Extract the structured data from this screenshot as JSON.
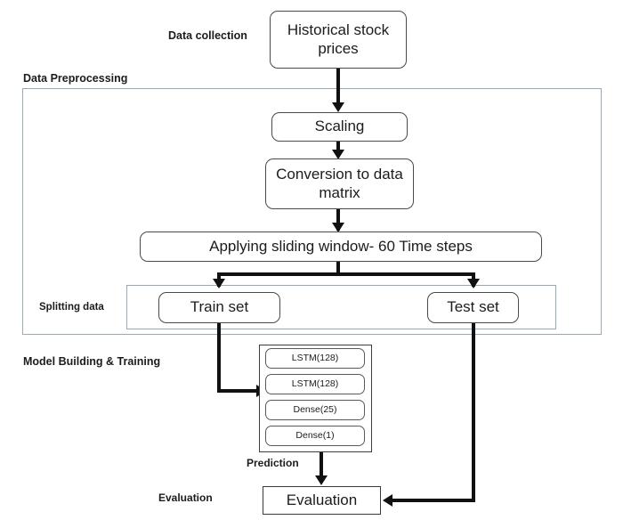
{
  "diagram": {
    "title": "Stock price prediction LSTM pipeline flowchart",
    "background_color": "#ffffff",
    "line_color": "#111111",
    "container_border_color": "#9aaab4",
    "node_border_color": "#4a4a4a"
  },
  "phases": [
    {
      "key": "data_collection",
      "label": "Data collection"
    },
    {
      "key": "data_preprocessing",
      "label": "Data Preprocessing"
    },
    {
      "key": "splitting_data",
      "label": "Splitting data"
    },
    {
      "key": "model_building",
      "label": "Model Building & Training"
    },
    {
      "key": "prediction",
      "label": "Prediction"
    },
    {
      "key": "evaluation",
      "label": "Evaluation"
    }
  ],
  "nodes": {
    "source": {
      "label": "Historical stock prices"
    },
    "scaling": {
      "label": "Scaling"
    },
    "conversion": {
      "label": "Conversion to data matrix"
    },
    "sliding_window": {
      "label": "Applying sliding window- 60 Time steps"
    },
    "train_set": {
      "label": "Train set"
    },
    "test_set": {
      "label": "Test set"
    },
    "evaluation": {
      "label": "Evaluation"
    }
  },
  "model_layers": [
    {
      "label": "LSTM(128)"
    },
    {
      "label": "LSTM(128)"
    },
    {
      "label": "Dense(25)"
    },
    {
      "label": "Dense(1)"
    }
  ]
}
